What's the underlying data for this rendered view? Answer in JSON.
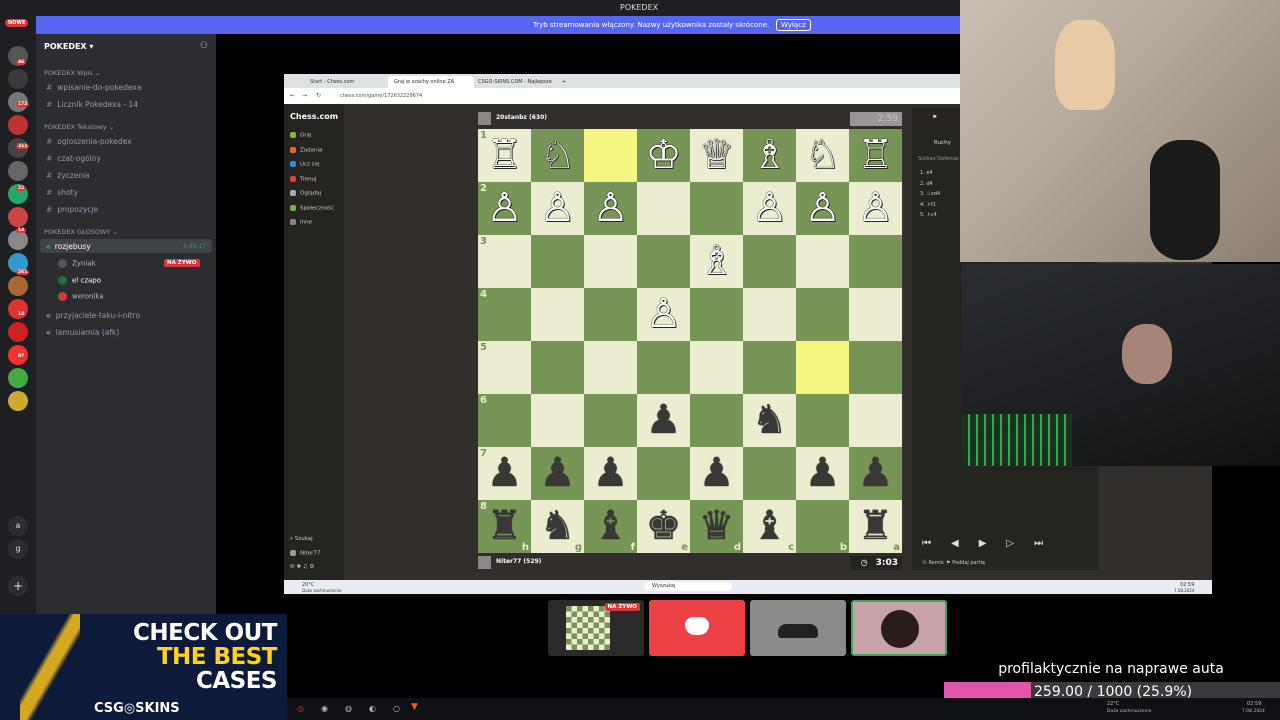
{
  "discord": {
    "window_title": "POKEDEX",
    "stream_banner": "Tryb streamowania włączony. Nazwy użytkownika zostały skrócone.",
    "stream_banner_button": "Wyłącz",
    "new_badge": "NOWE",
    "server_name": "POKEDEX",
    "rail_badges": [
      "46",
      "172",
      "311",
      "22",
      "14",
      "261",
      "14",
      "87"
    ],
    "categories": [
      {
        "label": "POKEDEX Wpis",
        "channels": [
          "wpisanie-do-pokedexa",
          "Licznik Pokedexa - 14"
        ]
      },
      {
        "label": "POKEDEX Tekstowy",
        "channels": [
          "ogloszenia-pokedex",
          "czat-ogólny",
          "życzenia",
          "shoty",
          "propozycje"
        ]
      },
      {
        "label": "POKEDEX GŁOSOWY",
        "channels": []
      }
    ],
    "voice_channel": {
      "name": "rozjebusy",
      "time": "3:49:17"
    },
    "voice_users": [
      {
        "name": "Żyniak",
        "live": "NA ŻYWO"
      },
      {
        "name": "el czapo",
        "live": ""
      },
      {
        "name": "weronika",
        "live": ""
      }
    ],
    "other_voice": [
      "przyjaciele-taku-i-nitro",
      "lamusiarnia (afk)"
    ]
  },
  "browser": {
    "tabs": [
      "Start - Chess.com",
      "Graj w szachy online ZA DARMO",
      "CSGO-SKINS.COM - Najlepsze"
    ],
    "url": "chess.com/game/172632229674",
    "brand": "Chess.com",
    "nav": [
      {
        "label": "Graj",
        "color": "#81b64c"
      },
      {
        "label": "Zadania",
        "color": "#e36b31"
      },
      {
        "label": "Ucz się",
        "color": "#2f8fd8"
      },
      {
        "label": "Trenuj",
        "color": "#d04646"
      },
      {
        "label": "Oglądaj",
        "color": "#aaaaaa"
      },
      {
        "label": "Społeczność",
        "color": "#6fb14a"
      },
      {
        "label": "Inne",
        "color": "#888888"
      }
    ],
    "nav_bottom": [
      "Szukaj",
      "Niter77"
    ],
    "top_player": "20stanbz (630)",
    "top_clock": "2:59",
    "bottom_player": "Niter77 (529)",
    "bottom_clock": "3:03",
    "right_panel": {
      "tab": "Ruchy",
      "opening": "Sicilian Defense: Sm...",
      "moves": [
        "1. e4",
        "2. d4",
        "3. ♘xd4",
        "4. ♗f1",
        "5. ♗c4"
      ],
      "actions": [
        "Remis",
        "Poddaj partię"
      ]
    },
    "taskbar": {
      "weather": "20°C",
      "weather_sub": "Duże zachmurzenie",
      "search": "Wyszukaj",
      "time": "02:59",
      "date": "7.08.2024"
    }
  },
  "board": {
    "light": "#ebecd0",
    "dark": "#779556",
    "highlight": "#f5f682",
    "highlight_squares": [
      "2,0",
      "6,4"
    ],
    "rank_labels": [
      "1",
      "2",
      "3",
      "4",
      "5",
      "6",
      "7",
      "8"
    ],
    "file_labels": [
      "h",
      "g",
      "f",
      "e",
      "d",
      "c",
      "b",
      "a"
    ],
    "pieces": [
      [
        "wR",
        "wN",
        "",
        "wK",
        "wQ",
        "wB",
        "wN",
        "wR"
      ],
      [
        "wP",
        "wP",
        "wP",
        "",
        "",
        "wP",
        "wP",
        "wP"
      ],
      [
        "",
        "",
        "",
        "",
        "wB",
        "",
        "",
        ""
      ],
      [
        "",
        "",
        "",
        "wP",
        "",
        "",
        "",
        ""
      ],
      [
        "",
        "",
        "",
        "",
        "",
        "",
        "",
        ""
      ],
      [
        "",
        "",
        "",
        "bP",
        "",
        "bN",
        "",
        ""
      ],
      [
        "bP",
        "bP",
        "bP",
        "",
        "bP",
        "",
        "bP",
        "bP"
      ],
      [
        "bR",
        "bN",
        "bB",
        "bK",
        "bQ",
        "bB",
        "",
        "bR"
      ]
    ]
  },
  "tiles": [
    {
      "name": "chess-stream",
      "badge": "NA ŻYWO",
      "color": "#2a2a2a"
    },
    {
      "name": "discord",
      "badge": "",
      "color": "#ed4245"
    },
    {
      "name": "car",
      "badge": "",
      "color": "#8a8a8a"
    },
    {
      "name": "avatar",
      "badge": "",
      "color": "#c7a3a8"
    }
  ],
  "ad": {
    "line1": "CHECK OUT",
    "line2": "THE BEST",
    "line3": "CASES",
    "brand": "CSG◎SKINS"
  },
  "goal": {
    "title": "profilaktycznie na naprawe auta",
    "text": "259.00 / 1000 (25.9%)",
    "progress": 0.259
  },
  "wtaskbar": {
    "weather": "22°C",
    "weather_sub": "Duże zachmurzenie",
    "time": "02:59",
    "date": "7.08.2024"
  }
}
